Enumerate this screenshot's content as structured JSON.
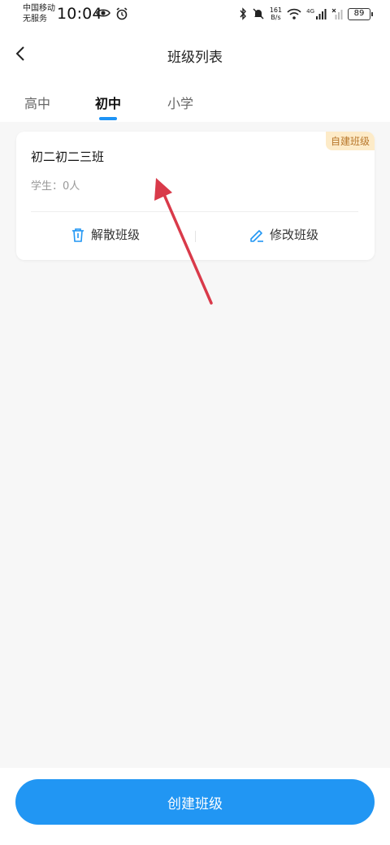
{
  "status_bar": {
    "carrier_line1": "中国移动",
    "carrier_line2": "无服务",
    "time": "10:04",
    "net_speed_value": "161",
    "net_speed_unit": "B/s",
    "signal_label": "4G",
    "battery": "89"
  },
  "header": {
    "title": "班级列表"
  },
  "tabs": [
    {
      "label": "高中"
    },
    {
      "label": "初中"
    },
    {
      "label": "小学"
    }
  ],
  "active_tab": "初中",
  "class_card": {
    "name": "初二初二三班",
    "badge": "自建班级",
    "students": "学生：0人",
    "dissolve_label": "解散班级",
    "modify_label": "修改班级"
  },
  "footer": {
    "create_label": "创建班级"
  },
  "colors": {
    "accent": "#2196f3",
    "tab_indicator": "#1e93f5",
    "badge_bg": "#fdebc8",
    "badge_text": "#b8772b",
    "annotation_arrow": "#d93a4a"
  }
}
